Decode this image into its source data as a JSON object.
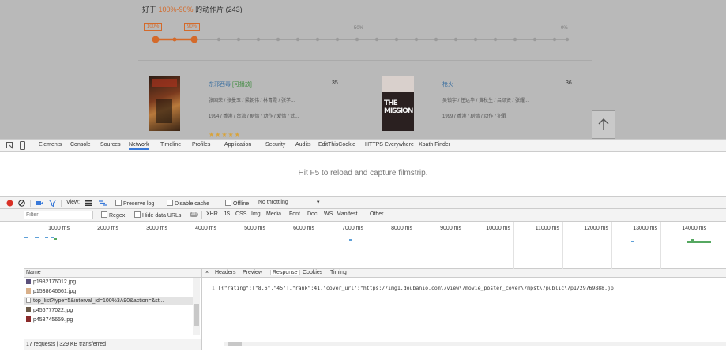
{
  "webpage": {
    "header_prefix": "好于",
    "header_pct": "100%-90%",
    "header_suffix": "的动作片 (243)",
    "slider_tags": [
      "100%",
      "90%"
    ],
    "slider_ticks": [
      "50%",
      "0%"
    ],
    "movies": [
      {
        "title": "东邪西毒",
        "play_tag": "[可播放]",
        "rank": "35",
        "cast": "张国荣 / 张曼玉 / 梁朝伟 / 林青霞 / 张学...",
        "meta": "1994 / 香港 / 台湾 / 剧情 / 动作 / 爱情 / 武...",
        "poster_text": ""
      },
      {
        "title": "枪火",
        "play_tag": "",
        "rank": "36",
        "cast": "吴镇宇 / 任达华 / 黄秋生 / 吕颂贤 / 张耀...",
        "meta": "1999 / 香港 / 剧情 / 动作 / 犯罪",
        "poster_text": "THE MISSION"
      }
    ],
    "back_top_icon": "arrow-up-icon"
  },
  "devtools": {
    "tabs": [
      "Elements",
      "Console",
      "Sources",
      "Network",
      "Timeline",
      "Profiles",
      "Application",
      "Security",
      "Audits",
      "EditThisCookie",
      "HTTPS Everywhere",
      "Xpath Finder"
    ],
    "active_tab": "Network",
    "filmstrip_message": "Hit F5 to reload and capture filmstrip.",
    "toolbar": {
      "view_label": "View:",
      "preserve_log": "Preserve log",
      "disable_cache": "Disable cache",
      "offline": "Offline",
      "throttling": "No throttling"
    },
    "filter": {
      "placeholder": "Filter",
      "regex": "Regex",
      "hide_data_urls": "Hide data URLs",
      "all": "All",
      "types": [
        "XHR",
        "JS",
        "CSS",
        "Img",
        "Media",
        "Font",
        "Doc",
        "WS",
        "Manifest",
        "Other"
      ]
    },
    "timeline_ticks": [
      "1000 ms",
      "2000 ms",
      "3000 ms",
      "4000 ms",
      "5000 ms",
      "6000 ms",
      "7000 ms",
      "8000 ms",
      "9000 ms",
      "10000 ms",
      "11000 ms",
      "12000 ms",
      "13000 ms",
      "14000 ms"
    ],
    "name_header": "Name",
    "requests": [
      {
        "name": "p1982176012.jpg",
        "selected": false,
        "icon": "image-file-icon"
      },
      {
        "name": "p1538646661.jpg",
        "selected": false,
        "icon": "image-file-icon"
      },
      {
        "name": "top_list?type=5&interval_id=100%3A90&action=&st...",
        "selected": true,
        "icon": "document-file-icon"
      },
      {
        "name": "p456777022.jpg",
        "selected": false,
        "icon": "image-file-icon"
      },
      {
        "name": "p453745659.jpg",
        "selected": false,
        "icon": "image-file-icon"
      }
    ],
    "status": "17 requests  |  329 KB transferred",
    "detail_tabs": [
      "Headers",
      "Preview",
      "Response",
      "Cookies",
      "Timing"
    ],
    "active_detail_tab": "Response",
    "response": {
      "line_no": "1",
      "text": "[{\"rating\":[\"8.6\",\"45\"],\"rank\":41,\"cover_url\":\"https://img1.doubanio.com\\/view\\/movie_poster_cover\\/mpst\\/public\\/p1729769888.jp"
    },
    "colors": {
      "record": "#d93025",
      "accent": "#3879d9"
    }
  }
}
